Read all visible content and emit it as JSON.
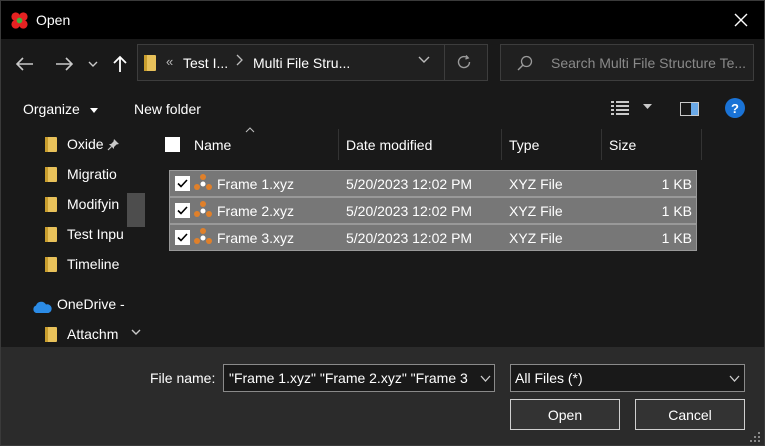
{
  "window": {
    "title": "Open",
    "close_icon": "close-icon",
    "app_icon": "red-clover-icon"
  },
  "navigation": {
    "back_icon": "arrow-left-icon",
    "forward_icon": "arrow-right-icon",
    "recent_icon": "chevron-down-icon",
    "up_icon": "arrow-up-icon",
    "address": {
      "overflow": "«",
      "crumbs": [
        "Test I...",
        "Multi File Stru..."
      ],
      "separator": ">",
      "refresh_icon": "refresh-icon"
    },
    "search": {
      "placeholder": "Search Multi File Structure Te..."
    }
  },
  "commands": {
    "organize": "Organize",
    "new_folder": "New folder",
    "view_icon": "details-view-icon",
    "preview_icon": "preview-pane-icon",
    "help": "?"
  },
  "sidebar": {
    "items": [
      {
        "label": "Oxide",
        "pinned": true
      },
      {
        "label": "Migratio"
      },
      {
        "label": "Modifyin"
      },
      {
        "label": "Test Inpu"
      },
      {
        "label": "Timeline"
      }
    ],
    "onedrive": {
      "label": "OneDrive -"
    },
    "sub_items": [
      {
        "label": "Attachm"
      }
    ]
  },
  "file_list": {
    "columns": {
      "name": "Name",
      "date": "Date modified",
      "type": "Type",
      "size": "Size"
    },
    "rows": [
      {
        "name": "Frame 1.xyz",
        "date": "5/20/2023 12:02 PM",
        "type": "XYZ File",
        "size": "1 KB",
        "checked": true
      },
      {
        "name": "Frame 2.xyz",
        "date": "5/20/2023 12:02 PM",
        "type": "XYZ File",
        "size": "1 KB",
        "checked": true
      },
      {
        "name": "Frame 3.xyz",
        "date": "5/20/2023 12:02 PM",
        "type": "XYZ File",
        "size": "1 KB",
        "checked": true
      }
    ]
  },
  "footer": {
    "file_name_label": "File name:",
    "file_name_value": "\"Frame 1.xyz\" \"Frame 2.xyz\" \"Frame 3",
    "filter_value": "All Files (*)",
    "open_label": "Open",
    "cancel_label": "Cancel"
  },
  "colors": {
    "accent": "#1a73d6",
    "folder": "#e8c15a",
    "selection": "#777777",
    "file_icon": "#e0802a"
  }
}
